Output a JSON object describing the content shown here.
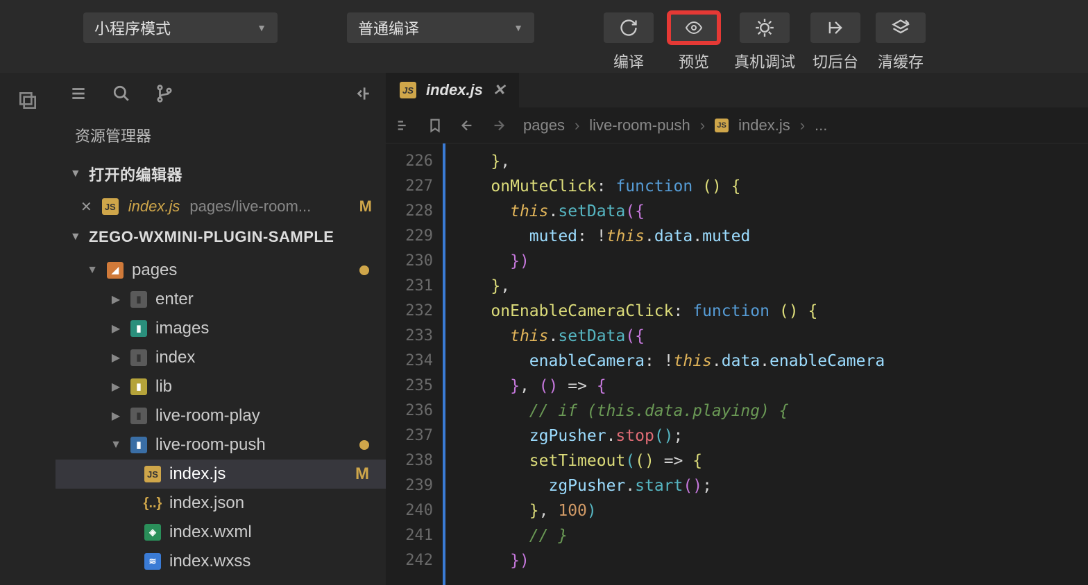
{
  "toolbar": {
    "mode_dropdown": "小程序模式",
    "compile_dropdown": "普通编译",
    "actions": {
      "compile": "编译",
      "preview": "预览",
      "remote_debug": "真机调试",
      "background": "切后台",
      "clear_cache": "清缓存"
    }
  },
  "sidebar": {
    "title": "资源管理器",
    "open_editors_label": "打开的编辑器",
    "open_editor": {
      "filename": "index.js",
      "path": "pages/live-room...",
      "modified": "M"
    },
    "project_name": "ZEGO-WXMINI-PLUGIN-SAMPLE",
    "tree": {
      "pages": "pages",
      "enter": "enter",
      "images": "images",
      "index": "index",
      "lib": "lib",
      "live_room_play": "live-room-play",
      "live_room_push": "live-room-push",
      "index_js": "index.js",
      "index_json": "index.json",
      "index_wxml": "index.wxml",
      "index_wxss": "index.wxss",
      "mod": "M"
    }
  },
  "editor": {
    "tab_name": "index.js",
    "breadcrumb": {
      "p1": "pages",
      "p2": "live-room-push",
      "p3": "index.js",
      "p4": "..."
    },
    "lines": [
      "226",
      "227",
      "228",
      "229",
      "230",
      "231",
      "232",
      "233",
      "234",
      "235",
      "236",
      "237",
      "238",
      "239",
      "240",
      "241",
      "242"
    ]
  }
}
